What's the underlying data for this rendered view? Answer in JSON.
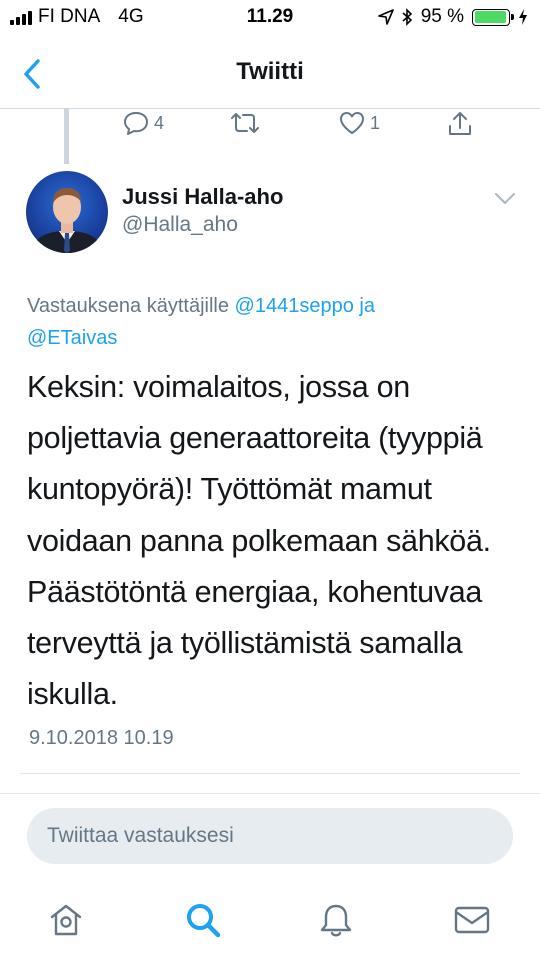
{
  "status_bar": {
    "carrier": "FI DNA",
    "network": "4G",
    "time": "11.29",
    "battery": "95 %",
    "battery_level": 0.95
  },
  "nav": {
    "title": "Twiitti"
  },
  "prev_tweet_actions": {
    "replies": "4",
    "retweets": "",
    "likes": "1"
  },
  "tweet": {
    "author_name": "Jussi Halla-aho",
    "author_handle": "@Halla_aho",
    "reply_prefix": "Vastauksena käyttäjille ",
    "mention1": "@1441seppo",
    "reply_joiner": " ja",
    "mention2": "@ETaivas",
    "text": "Keksin: voimalaitos, jossa on poljettavia generaattoreita (tyyppiä kuntopyörä)! Työttömät mamut voidaan panna polkemaan sähköä. Päästötöntä energiaa, kohentuvaa terveyttä ja työllistämistä samalla iskulla.",
    "timestamp": "9.10.2018 10.19"
  },
  "reply_box": {
    "placeholder": "Twiittaa vastauksesi"
  },
  "colors": {
    "accent": "#1da1f2",
    "secondary_text": "#657786",
    "primary_text": "#14171a",
    "reply_box_bg": "#e6ecf0"
  },
  "icons": {
    "back": "chevron-left-icon",
    "reply": "comment-icon",
    "retweet": "retweet-icon",
    "like": "heart-icon",
    "share": "share-icon",
    "more": "chevron-down-icon",
    "home": "home-icon",
    "search": "search-icon",
    "notifications": "bell-icon",
    "messages": "envelope-icon"
  }
}
